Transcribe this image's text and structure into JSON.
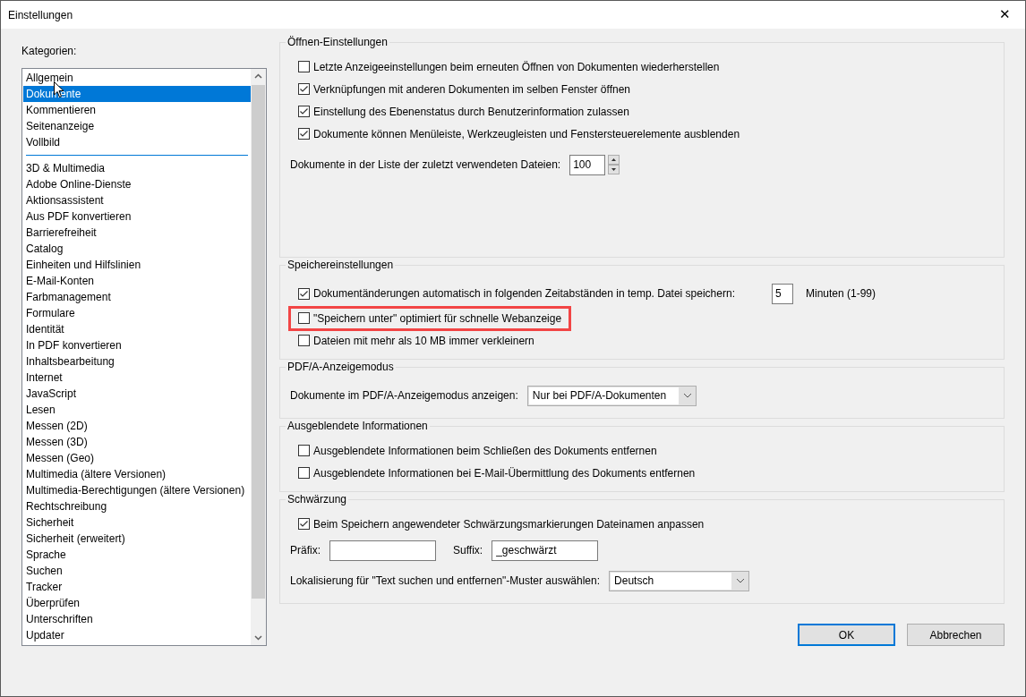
{
  "window": {
    "title": "Einstellungen",
    "close_glyph": "✕"
  },
  "categories": {
    "label": "Kategorien:",
    "groups": [
      {
        "items": [
          {
            "label": "Allgemein",
            "selected": false
          },
          {
            "label": "Dokumente",
            "selected": true
          },
          {
            "label": "Kommentieren",
            "selected": false
          },
          {
            "label": "Seitenanzeige",
            "selected": false
          },
          {
            "label": "Vollbild",
            "selected": false
          }
        ]
      },
      {
        "items": [
          {
            "label": "3D & Multimedia",
            "selected": false
          },
          {
            "label": "Adobe Online-Dienste",
            "selected": false
          },
          {
            "label": "Aktionsassistent",
            "selected": false
          },
          {
            "label": "Aus PDF konvertieren",
            "selected": false
          },
          {
            "label": "Barrierefreiheit",
            "selected": false
          },
          {
            "label": "Catalog",
            "selected": false
          },
          {
            "label": "Einheiten und Hilfslinien",
            "selected": false
          },
          {
            "label": "E-Mail-Konten",
            "selected": false
          },
          {
            "label": "Farbmanagement",
            "selected": false
          },
          {
            "label": "Formulare",
            "selected": false
          },
          {
            "label": "Identität",
            "selected": false
          },
          {
            "label": "In PDF konvertieren",
            "selected": false
          },
          {
            "label": "Inhaltsbearbeitung",
            "selected": false
          },
          {
            "label": "Internet",
            "selected": false
          },
          {
            "label": "JavaScript",
            "selected": false
          },
          {
            "label": "Lesen",
            "selected": false
          },
          {
            "label": "Messen (2D)",
            "selected": false
          },
          {
            "label": "Messen (3D)",
            "selected": false
          },
          {
            "label": "Messen (Geo)",
            "selected": false
          },
          {
            "label": "Multimedia (ältere Versionen)",
            "selected": false
          },
          {
            "label": "Multimedia-Berechtigungen (ältere Versionen)",
            "selected": false
          },
          {
            "label": "Rechtschreibung",
            "selected": false
          },
          {
            "label": "Sicherheit",
            "selected": false
          },
          {
            "label": "Sicherheit (erweitert)",
            "selected": false
          },
          {
            "label": "Sprache",
            "selected": false
          },
          {
            "label": "Suchen",
            "selected": false
          },
          {
            "label": "Tracker",
            "selected": false
          },
          {
            "label": "Überprüfen",
            "selected": false
          },
          {
            "label": "Unterschriften",
            "selected": false
          },
          {
            "label": "Updater",
            "selected": false
          }
        ]
      }
    ]
  },
  "sections": [
    {
      "title": "Öffnen-Einstellungen",
      "rows": [
        {
          "kind": "checkbox",
          "label": "Letzte Anzeigeeinstellungen beim erneuten Öffnen von Dokumenten wiederherstellen",
          "checked": false,
          "highlighted": false
        },
        {
          "kind": "checkbox",
          "label": "Verknüpfungen mit anderen Dokumenten im selben Fenster öffnen",
          "checked": true,
          "highlighted": false
        },
        {
          "kind": "checkbox",
          "label": "Einstellung des Ebenenstatus durch Benutzerinformation zulassen",
          "checked": true,
          "highlighted": false
        },
        {
          "kind": "checkbox",
          "label": "Dokumente können Menüleiste, Werkzeugleisten und Fenstersteuerelemente ausblenden",
          "checked": true,
          "highlighted": false
        },
        {
          "kind": "spinner",
          "label": "Dokumente in der Liste der zuletzt verwendeten Dateien:",
          "value": "100"
        }
      ]
    },
    {
      "title": "Speichereinstellungen",
      "rows": [
        {
          "kind": "checkbox_number",
          "label": "Dokumentänderungen automatisch in folgenden Zeitabständen in temp. Datei speichern:",
          "checked": true,
          "value": "5",
          "suffix": "Minuten (1-99)"
        },
        {
          "kind": "checkbox",
          "label": "\"Speichern unter\" optimiert für schnelle Webanzeige",
          "checked": false,
          "highlighted": true
        },
        {
          "kind": "checkbox",
          "label": "Dateien mit mehr als 10 MB immer verkleinern",
          "checked": false,
          "highlighted": false
        }
      ]
    },
    {
      "title": "PDF/A-Anzeigemodus",
      "rows": [
        {
          "kind": "select",
          "label": "Dokumente im PDF/A-Anzeigemodus anzeigen:",
          "value": "Nur bei PDF/A-Dokumenten"
        }
      ]
    },
    {
      "title": "Ausgeblendete Informationen",
      "rows": [
        {
          "kind": "checkbox",
          "label": "Ausgeblendete Informationen beim Schließen des Dokuments entfernen",
          "checked": false,
          "highlighted": false
        },
        {
          "kind": "checkbox",
          "label": "Ausgeblendete Informationen bei E-Mail-Übermittlung des Dokuments entfernen",
          "checked": false,
          "highlighted": false
        }
      ]
    },
    {
      "title": "Schwärzung",
      "rows": [
        {
          "kind": "checkbox",
          "label": "Beim Speichern angewendeter Schwärzungsmarkierungen Dateinamen anpassen",
          "checked": true,
          "highlighted": false
        },
        {
          "kind": "fields",
          "fields": [
            {
              "label": "Präfix:"
            },
            {
              "label": "Suffix:",
              "value": "_geschwärzt"
            }
          ]
        },
        {
          "kind": "select",
          "label": "Lokalisierung für \"Text suchen und entfernen\"-Muster auswählen:",
          "value": "Deutsch"
        }
      ]
    }
  ],
  "buttons": [
    {
      "label": "OK",
      "default": true
    },
    {
      "label": "Abbrechen",
      "default": false
    }
  ]
}
